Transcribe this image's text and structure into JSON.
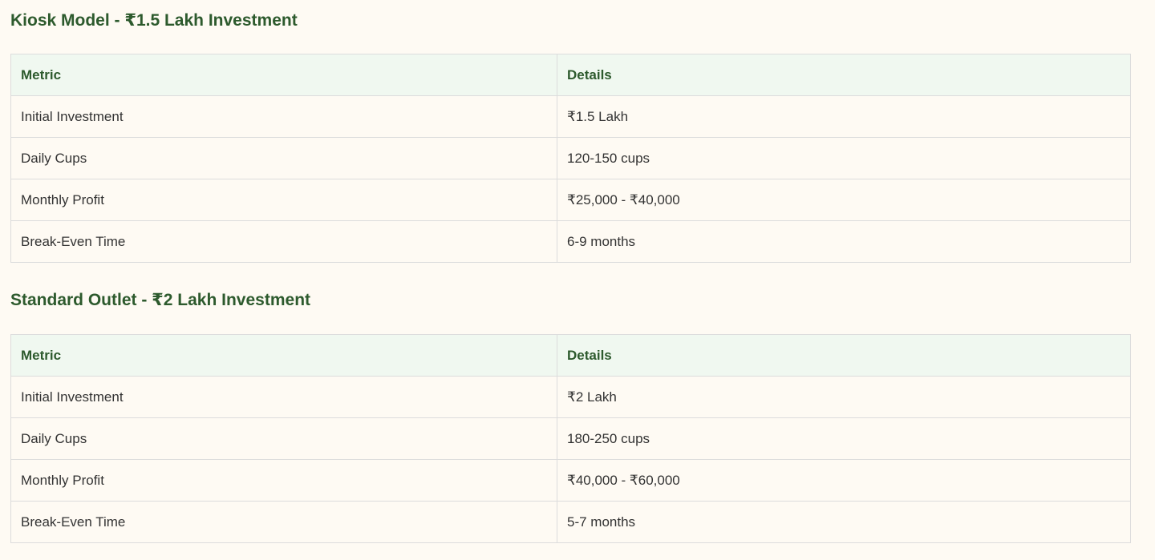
{
  "sections": [
    {
      "title": "Kiosk Model - ₹1.5 Lakh Investment",
      "headers": [
        "Metric",
        "Details"
      ],
      "rows": [
        [
          "Initial Investment",
          "₹1.5 Lakh"
        ],
        [
          "Daily Cups",
          "120-150 cups"
        ],
        [
          "Monthly Profit",
          "₹25,000 - ₹40,000"
        ],
        [
          "Break-Even Time",
          "6-9 months"
        ]
      ]
    },
    {
      "title": "Standard Outlet - ₹2 Lakh Investment",
      "headers": [
        "Metric",
        "Details"
      ],
      "rows": [
        [
          "Initial Investment",
          "₹2 Lakh"
        ],
        [
          "Daily Cups",
          "180-250 cups"
        ],
        [
          "Monthly Profit",
          "₹40,000 - ₹60,000"
        ],
        [
          "Break-Even Time",
          "5-7 months"
        ]
      ]
    }
  ],
  "colors": {
    "heading": "#2d5a2d",
    "header_bg": "#f0f8f0",
    "page_bg": "#fefaf3",
    "border": "#dcdcdc",
    "text": "#333333"
  }
}
